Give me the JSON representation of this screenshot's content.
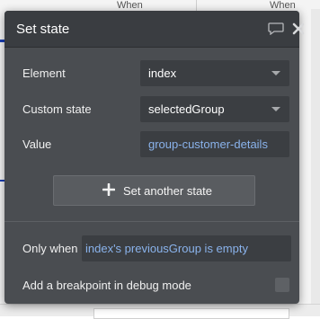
{
  "background": {
    "col1": "When",
    "col2": "When"
  },
  "dialog": {
    "title": "Set state",
    "rows": {
      "element": {
        "label": "Element",
        "value": "index"
      },
      "custom_state": {
        "label": "Custom state",
        "value": "selectedGroup"
      },
      "value": {
        "label": "Value",
        "value": "group-customer-details"
      }
    },
    "add_button": "Set another state",
    "only_when": {
      "label": "Only when",
      "value": "index's previousGroup is empty"
    },
    "breakpoint_label": "Add a breakpoint in debug mode"
  },
  "colors": {
    "dialog_bg": "#4a4d51",
    "header_bg": "#3a3d41",
    "field_bg": "#3b3e42",
    "expression_text": "#8ab3ec"
  },
  "icons": {
    "comment": "comment-icon",
    "close": "close-icon",
    "plus": "plus-icon",
    "dropdown": "chevron-down-icon"
  }
}
